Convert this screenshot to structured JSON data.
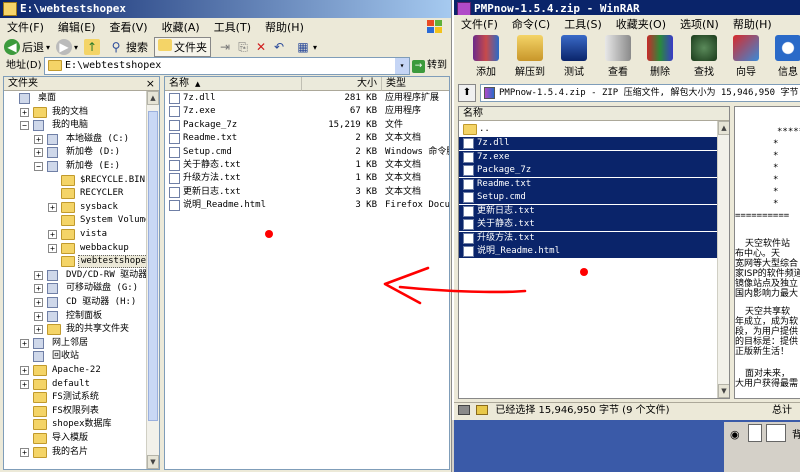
{
  "explorer": {
    "title": "E:\\webtestshopex",
    "menu": [
      "文件(F)",
      "编辑(E)",
      "查看(V)",
      "收藏(A)",
      "工具(T)",
      "帮助(H)"
    ],
    "toolbar": {
      "back": "后退",
      "search": "搜索",
      "folders": "文件夹"
    },
    "address_label": "地址(D)",
    "address_value": "E:\\webtestshopex",
    "go_label": "转到",
    "folder_pane_title": "文件夹",
    "close_glyph": "×",
    "tree": [
      {
        "label": "桌面",
        "level": 0,
        "toggle": "",
        "icon": "desktop-icon"
      },
      {
        "label": "我的文档",
        "level": 1,
        "toggle": "+",
        "icon": "documents-folder-icon"
      },
      {
        "label": "我的电脑",
        "level": 1,
        "toggle": "−",
        "icon": "computer-icon"
      },
      {
        "label": "本地磁盘 (C:)",
        "level": 2,
        "toggle": "+",
        "icon": "drive-icon"
      },
      {
        "label": "新加卷 (D:)",
        "level": 2,
        "toggle": "+",
        "icon": "drive-icon"
      },
      {
        "label": "新加卷 (E:)",
        "level": 2,
        "toggle": "−",
        "icon": "drive-icon"
      },
      {
        "label": "$RECYCLE.BIN",
        "level": 3,
        "toggle": "",
        "icon": "folder-icon"
      },
      {
        "label": "RECYCLER",
        "level": 3,
        "toggle": "",
        "icon": "folder-icon"
      },
      {
        "label": "sysback",
        "level": 3,
        "toggle": "+",
        "icon": "folder-icon"
      },
      {
        "label": "System Volume Inf",
        "level": 3,
        "toggle": "",
        "icon": "folder-icon"
      },
      {
        "label": "vista",
        "level": 3,
        "toggle": "+",
        "icon": "folder-icon"
      },
      {
        "label": "webbackup",
        "level": 3,
        "toggle": "+",
        "icon": "folder-icon"
      },
      {
        "label": "webtestshopex",
        "level": 3,
        "toggle": "",
        "icon": "open-folder-icon",
        "selected": true
      },
      {
        "label": "DVD/CD-RW 驱动器 (F:",
        "level": 2,
        "toggle": "+",
        "icon": "dvd-drive-icon"
      },
      {
        "label": "可移动磁盘 (G:)",
        "level": 2,
        "toggle": "+",
        "icon": "removable-disk-icon"
      },
      {
        "label": "CD 驱动器 (H:)",
        "level": 2,
        "toggle": "+",
        "icon": "cd-drive-icon"
      },
      {
        "label": "控制面板",
        "level": 2,
        "toggle": "+",
        "icon": "control-panel-icon"
      },
      {
        "label": "我的共享文件夹",
        "level": 2,
        "toggle": "+",
        "icon": "shared-folder-icon"
      },
      {
        "label": "网上邻居",
        "level": 1,
        "toggle": "+",
        "icon": "network-icon"
      },
      {
        "label": "回收站",
        "level": 1,
        "toggle": "",
        "icon": "recycle-bin-icon"
      },
      {
        "label": "Apache-22",
        "level": 1,
        "toggle": "+",
        "icon": "folder-icon"
      },
      {
        "label": "default",
        "level": 1,
        "toggle": "+",
        "icon": "folder-icon"
      },
      {
        "label": "FS测试系统",
        "level": 1,
        "toggle": "",
        "icon": "folder-icon"
      },
      {
        "label": "FS权限列表",
        "level": 1,
        "toggle": "",
        "icon": "folder-icon"
      },
      {
        "label": "shopex数据库",
        "level": 1,
        "toggle": "",
        "icon": "folder-icon"
      },
      {
        "label": "导入模版",
        "level": 1,
        "toggle": "",
        "icon": "folder-icon"
      },
      {
        "label": "我的名片",
        "level": 1,
        "toggle": "+",
        "icon": "folder-icon"
      }
    ],
    "columns": {
      "name": "名称",
      "size": "大小",
      "type": "类型"
    },
    "sort_glyph": "▲",
    "files": [
      {
        "name": "7z.dll",
        "size": "281 KB",
        "type": "应用程序扩展"
      },
      {
        "name": "7z.exe",
        "size": "67 KB",
        "type": "应用程序"
      },
      {
        "name": "Package_7z",
        "size": "15,219 KB",
        "type": "文件"
      },
      {
        "name": "Readme.txt",
        "size": "2 KB",
        "type": "文本文档"
      },
      {
        "name": "Setup.cmd",
        "size": "2 KB",
        "type": "Windows 命令脚本"
      },
      {
        "name": "关于静态.txt",
        "size": "1 KB",
        "type": "文本文档"
      },
      {
        "name": "升级方法.txt",
        "size": "1 KB",
        "type": "文本文档"
      },
      {
        "name": "更新日志.txt",
        "size": "3 KB",
        "type": "文本文档"
      },
      {
        "name": "说明_Readme.html",
        "size": "3 KB",
        "type": "Firefox Document"
      }
    ]
  },
  "winrar": {
    "title": "PMPnow-1.5.4.zip - WinRAR",
    "menu": [
      "文件(F)",
      "命令(C)",
      "工具(S)",
      "收藏夹(O)",
      "选项(N)",
      "帮助(H)"
    ],
    "toolbar": [
      "添加",
      "解压到",
      "测试",
      "查看",
      "删除",
      "查找",
      "向导",
      "信息"
    ],
    "path": "PMPnow-1.5.4.zip - ZIP 压缩文件, 解包大小为 15,946,950 字节",
    "column_name": "名称",
    "up_entry": "..",
    "files": [
      "7z.dll",
      "7z.exe",
      "Package_7z",
      "Readme.txt",
      "Setup.cmd",
      "更新日志.txt",
      "关于静态.txt",
      "升级方法.txt",
      "说明_Readme.html"
    ],
    "status": "已经选择 15,946,950 字节 (9 个文件)",
    "status_right": "总计",
    "comment": {
      "stars": [
        "*****",
        "*",
        "*",
        "*",
        "*",
        "*",
        "*"
      ],
      "rule": "==========",
      "para1": [
        "天空软件站",
        "布中心。天",
        "宽网等大型综合",
        "家ISP的软件频道",
        "镜像站点及独立",
        "国内影响力最大"
      ],
      "para2": [
        "天空共享软",
        "年成立，成为软",
        "段，为用户提供",
        "的目标是：提供",
        "正版新生活！"
      ],
      "para3": [
        "面对未来，",
        "大用户获得最需"
      ]
    }
  },
  "taskbar": {
    "partial_label": "背"
  },
  "colors": {
    "titlebar_left": "#0a246a",
    "titlebar_right": "#a6caf0",
    "selection": "#0a246a",
    "annotation": "#ff0000"
  }
}
